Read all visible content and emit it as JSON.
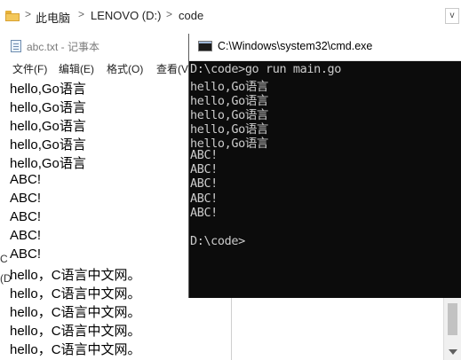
{
  "explorer": {
    "folder_icon": "folder-icon",
    "breadcrumb": [
      "此电脑",
      "LENOVO (D:)",
      "code"
    ],
    "separator": ">",
    "dropdown_glyph": "v"
  },
  "notepad": {
    "title": "abc.txt - 记事本",
    "menus": [
      "文件(F)",
      "编辑(E)",
      "格式(O)",
      "查看(V"
    ],
    "lines": [
      "hello,Go语言",
      "hello,Go语言",
      "hello,Go语言",
      "hello,Go语言",
      "hello,Go语言",
      "ABC!",
      "ABC!",
      "ABC!",
      "ABC!",
      "ABC!",
      "hello，C语言中文网。",
      "hello，C语言中文网。",
      "hello，C语言中文网。",
      "hello，C语言中文网。",
      "hello，C语言中文网。"
    ],
    "left_fragments": [
      "C",
      "(D"
    ]
  },
  "cmd": {
    "title": "C:\\Windows\\system32\\cmd.exe",
    "lines": [
      "D:\\code>go run main.go",
      "hello,Go语言",
      "hello,Go语言",
      "hello,Go语言",
      "hello,Go语言",
      "hello,Go语言",
      "ABC!",
      "ABC!",
      "ABC!",
      "ABC!",
      "ABC!",
      "",
      "D:\\code>"
    ],
    "colors": {
      "background": "#0c0c0c",
      "text": "#cccccc"
    }
  }
}
